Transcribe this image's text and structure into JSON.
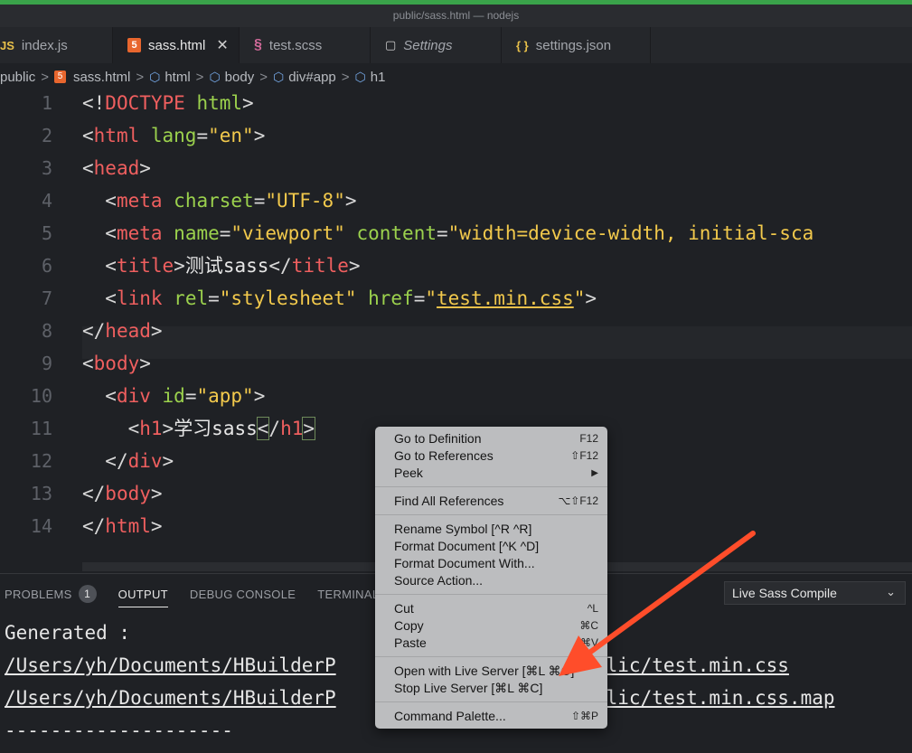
{
  "window": {
    "title": "public/sass.html — nodejs"
  },
  "tabs": [
    {
      "icon": "JS",
      "label": "index.js"
    },
    {
      "icon": "5",
      "label": "sass.html",
      "close": "✕"
    },
    {
      "icon": "§",
      "label": "test.scss"
    },
    {
      "icon": "▢",
      "label": "Settings"
    },
    {
      "icon": "{ }",
      "label": "settings.json"
    }
  ],
  "breadcrumb": {
    "items": [
      "public",
      "sass.html",
      "html",
      "body",
      "div#app",
      "h1"
    ],
    "separator": ">"
  },
  "editor": {
    "line_numbers": [
      "1",
      "2",
      "3",
      "4",
      "5",
      "6",
      "7",
      "8",
      "9",
      "10",
      "11",
      "12",
      "13",
      "14"
    ],
    "lines": {
      "l1": {
        "p1": "<!",
        "t1": "DOCTYPE",
        "a1": " html",
        "p2": ">"
      },
      "l2": {
        "p1": "<",
        "t1": "html",
        "a1": " lang",
        "p2": "=",
        "s1": "\"en\"",
        "p3": ">"
      },
      "l3": {
        "p1": "<",
        "t1": "head",
        "p2": ">"
      },
      "l4": {
        "g": "  ",
        "p1": "<",
        "t1": "meta",
        "a1": " charset",
        "p2": "=",
        "s1": "\"UTF-8\"",
        "p3": ">"
      },
      "l5": {
        "g": "  ",
        "p1": "<",
        "t1": "meta",
        "a1": " name",
        "p2": "=",
        "s1": "\"viewport\"",
        "a2": " content",
        "p3": "=",
        "s2": "\"width=device-width, initial-sca"
      },
      "l6": {
        "g": "  ",
        "p1": "<",
        "t1": "title",
        "p2": ">",
        "x1": "测试sass",
        "p3": "</",
        "t2": "title",
        "p4": ">"
      },
      "l7": {
        "g": "  ",
        "p1": "<",
        "t1": "link",
        "a1": " rel",
        "p2": "=",
        "s1": "\"stylesheet\"",
        "a2": " href",
        "p3": "=",
        "s2": "\"",
        "s3": "test.min.css",
        "s4": "\"",
        "p4": ">"
      },
      "l8": {
        "p1": "</",
        "t1": "head",
        "p2": ">"
      },
      "l9": {
        "p1": "<",
        "t1": "body",
        "p2": ">"
      },
      "l10": {
        "g": "  ",
        "p1": "<",
        "t1": "div",
        "a1": " id",
        "p2": "=",
        "s1": "\"app\"",
        "p3": ">"
      },
      "l11": {
        "g": "    ",
        "p1": "<",
        "t1": "h1",
        "p2": ">",
        "x1": "学习sass",
        "p3": "<",
        "p3b": "/",
        "t2": "h1",
        "p4": ">"
      },
      "l12": {
        "g": "  ",
        "p1": "</",
        "t1": "div",
        "p2": ">"
      },
      "l13": {
        "p1": "</",
        "t1": "body",
        "p2": ">"
      },
      "l14": {
        "p1": "</",
        "t1": "html",
        "p2": ">"
      }
    }
  },
  "panel": {
    "tabs": {
      "problems": "PROBLEMS",
      "problems_count": "1",
      "output": "OUTPUT",
      "debug": "DEBUG CONSOLE",
      "terminal": "TERMINAL"
    },
    "channel": "Live Sass Compile",
    "output_lines": [
      "Generated :",
      "/Users/yh/Documents/HBuilderP",
      "/Users/yh/Documents/HBuilderP",
      "--------------------"
    ],
    "output_tails": [
      "blic/test.min.css",
      "blic/test.min.css.map"
    ]
  },
  "context_menu": {
    "items": [
      {
        "label": "Go to Definition",
        "shortcut": "F12"
      },
      {
        "label": "Go to References",
        "shortcut": "⇧F12"
      },
      {
        "label": "Peek",
        "shortcut": "▶"
      },
      {
        "label": "Find All References",
        "shortcut": "⌥⇧F12"
      },
      {
        "label": "Rename Symbol [^R ^R]",
        "shortcut": ""
      },
      {
        "label": "Format Document [^K ^D]",
        "shortcut": ""
      },
      {
        "label": "Format Document With...",
        "shortcut": ""
      },
      {
        "label": "Source Action...",
        "shortcut": ""
      },
      {
        "label": "Cut",
        "shortcut": "^L"
      },
      {
        "label": "Copy",
        "shortcut": "⌘C"
      },
      {
        "label": "Paste",
        "shortcut": "⌘V"
      },
      {
        "label": "Open with Live Server [⌘L ⌘O]",
        "shortcut": ""
      },
      {
        "label": "Stop Live Server [⌘L ⌘C]",
        "shortcut": ""
      },
      {
        "label": "Command Palette...",
        "shortcut": "⇧⌘P"
      }
    ]
  },
  "colors": {
    "arrow": "#ff4d2a",
    "tag": "#ef5f5f",
    "attr": "#9bd14d",
    "string": "#f2c94c",
    "html_icon": "#e8662e"
  }
}
